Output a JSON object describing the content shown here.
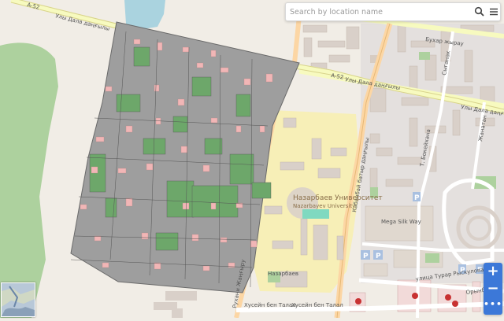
{
  "search": {
    "placeholder": "Search by location name"
  },
  "map": {
    "labels": {
      "road_top": "Улы Дала даңғылы",
      "road_a52_top": "A-52",
      "road_mid": "Улы Дала даңғылы",
      "road_a52_mid": "A-52",
      "road_right": "Улы Дала даңғылы",
      "avenue_vertical": "Кабанбай батыр даңғылы",
      "street_right_1": "Бухар жырау",
      "street_right_2": "Сыганак",
      "street_right_3": "Т. Бокейхана",
      "street_right_4": "Жанатан",
      "university": "Назарбаев Университет",
      "university_sub": "Nazarbayev University",
      "mega": "Mega Silk Way",
      "street_bottom_1": "Рухани Жаңғыру",
      "street_bottom_2": "Хусейн бен Талал",
      "street_bottom_3": "Хусейн бен Талал",
      "street_bottom_4": "Орынбор",
      "street_bottom_5": "улица Турар Рыскулова",
      "small_1": "Назарбаев",
      "parking": "P"
    }
  },
  "controls": {
    "zoom_in": "+",
    "zoom_out": "−",
    "more": "•••"
  }
}
